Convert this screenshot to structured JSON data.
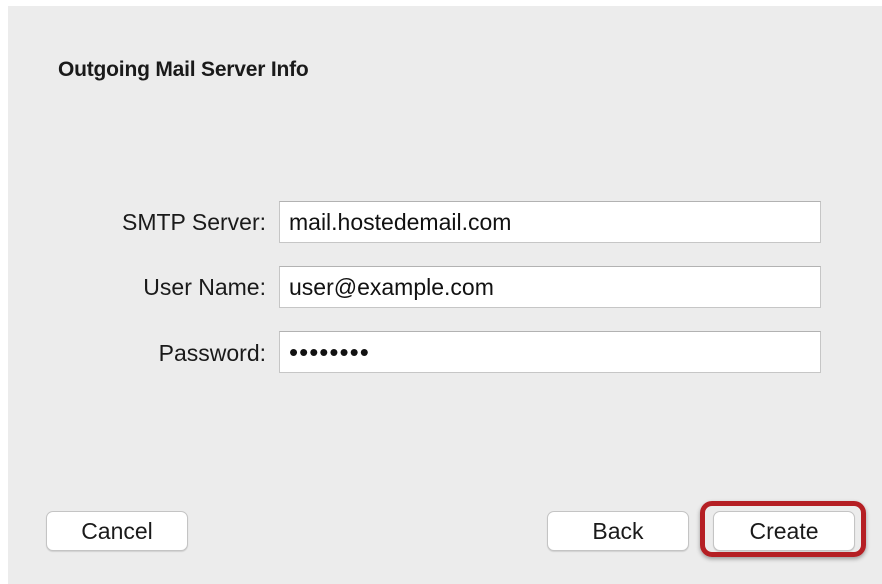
{
  "dialog": {
    "title": "Outgoing Mail Server Info"
  },
  "form": {
    "smtp_server": {
      "label": "SMTP Server:",
      "value": "mail.hostedemail.com"
    },
    "user_name": {
      "label": "User Name:",
      "value": "user@example.com"
    },
    "password": {
      "label": "Password:",
      "value": "••••••••"
    }
  },
  "buttons": {
    "cancel": "Cancel",
    "back": "Back",
    "create": "Create"
  },
  "colors": {
    "panel_background": "#ececec",
    "highlight": "#b51f24"
  }
}
